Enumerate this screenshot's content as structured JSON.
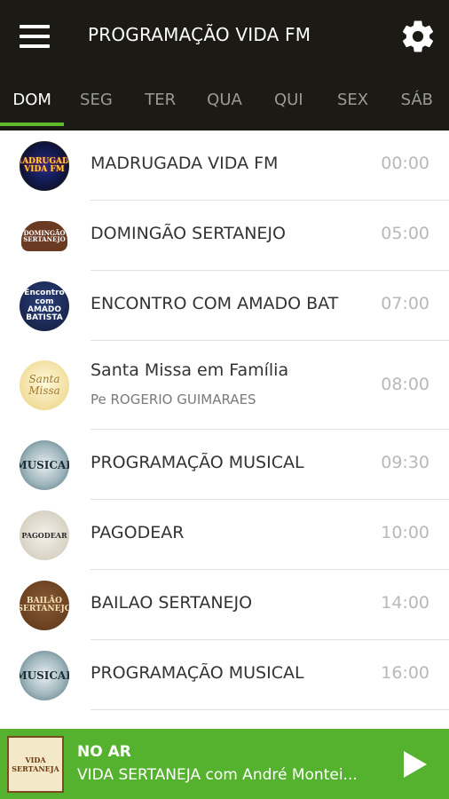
{
  "header": {
    "title": "PROGRAMAÇÃO VIDA FM"
  },
  "tabs": [
    {
      "label": "DOM",
      "active": true
    },
    {
      "label": "SEG",
      "active": false
    },
    {
      "label": "TER",
      "active": false
    },
    {
      "label": "QUA",
      "active": false
    },
    {
      "label": "QUI",
      "active": false
    },
    {
      "label": "SEX",
      "active": false
    },
    {
      "label": "SÁB",
      "active": false
    }
  ],
  "schedule": [
    {
      "name": "MADRUGADA VIDA FM",
      "time": "00:00",
      "logo_text": "MADRUGADA VIDA FM"
    },
    {
      "name": "DOMINGÃO SERTANEJO",
      "time": "05:00",
      "logo_text": "DOMINGÃO SERTANEJO"
    },
    {
      "name": "ENCONTRO COM AMADO BAT",
      "time": "07:00",
      "logo_text": "Encontro com AMADO BATISTA"
    },
    {
      "name": "Santa Missa em Família",
      "host": "Pe ROGERIO GUIMARAES",
      "time": "08:00",
      "logo_text": "Santa Missa"
    },
    {
      "name": "PROGRAMAÇÃO MUSICAL",
      "time": "09:30",
      "logo_text": "MUSICAL"
    },
    {
      "name": "PAGODEAR",
      "time": "10:00",
      "logo_text": "PAGODEAR"
    },
    {
      "name": "BAILAO SERTANEJO",
      "time": "14:00",
      "logo_text": "BAILÃO SERTANEJO"
    },
    {
      "name": "PROGRAMAÇÃO MUSICAL",
      "time": "16:00",
      "logo_text": "MUSICAL"
    }
  ],
  "player": {
    "status": "NO AR",
    "now_playing": "VIDA SERTANEJA com André Montei...",
    "logo_text": "VIDA SERTANEJA"
  },
  "colors": {
    "appbar": "#1c1a14",
    "accent": "#5dbb2a",
    "player": "#55b22e"
  },
  "icons": {
    "menu": "hamburger-menu-icon",
    "settings": "gear-icon",
    "play": "play-icon"
  }
}
